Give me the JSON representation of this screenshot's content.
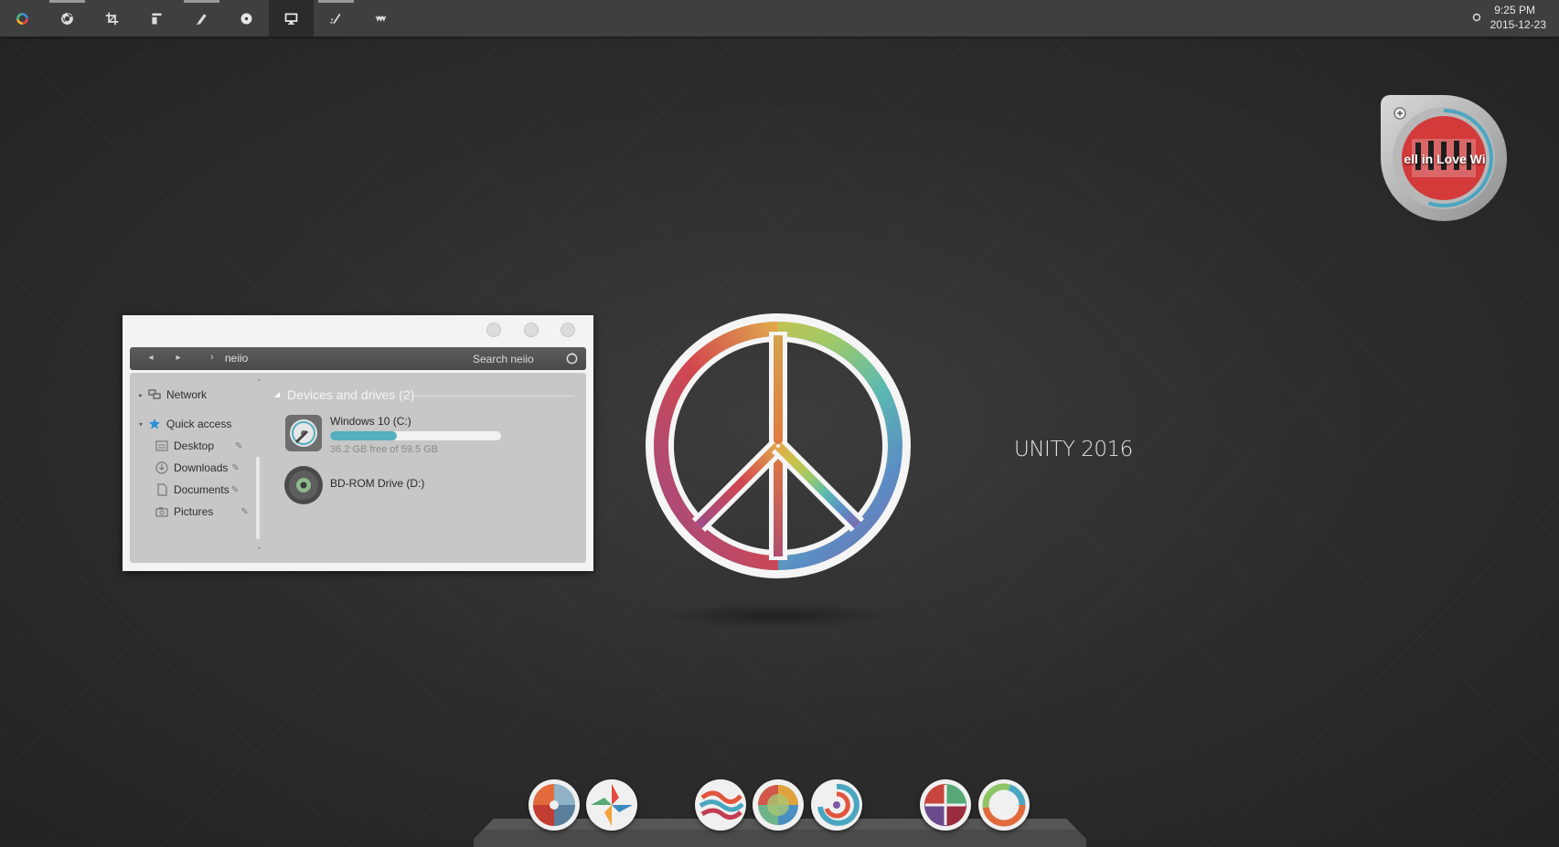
{
  "taskbar": {
    "buttons": [
      {
        "name": "color-ring-icon",
        "active": false,
        "open": false
      },
      {
        "name": "chrome-icon",
        "active": false,
        "open": true
      },
      {
        "name": "crop-tool-icon",
        "active": false,
        "open": false
      },
      {
        "name": "layout-icon",
        "active": false,
        "open": false
      },
      {
        "name": "brush-icon",
        "active": false,
        "open": true
      },
      {
        "name": "record-icon",
        "active": false,
        "open": false
      },
      {
        "name": "monitor-icon",
        "active": true,
        "open": false
      },
      {
        "name": "pen-icon",
        "active": false,
        "open": true
      },
      {
        "name": "bat-icon",
        "active": false,
        "open": false
      }
    ],
    "clock": {
      "time": "9:25 PM",
      "date": "2015-12-23"
    }
  },
  "explorer": {
    "path": "neiio",
    "search_placeholder": "Search neiio",
    "nav_items": [
      {
        "label": "Network",
        "icon": "network-icon",
        "pinned": false
      },
      {
        "label": "Quick access",
        "icon": "star-icon",
        "pinned": false
      },
      {
        "label": "Desktop",
        "icon": "desktop-icon",
        "pinned": true
      },
      {
        "label": "Downloads",
        "icon": "download-icon",
        "pinned": true
      },
      {
        "label": "Documents",
        "icon": "document-icon",
        "pinned": true
      },
      {
        "label": "Pictures",
        "icon": "camera-icon",
        "pinned": true
      }
    ],
    "section_title": "Devices and drives (2)",
    "drives": [
      {
        "name": "Windows 10 (C:)",
        "free_text": "36.2 GB free of 59.5 GB",
        "used_fraction": 0.39,
        "icon": "hard-drive-icon"
      },
      {
        "name": "BD-ROM Drive (D:)",
        "free_text": "",
        "icon": "disc-drive-icon"
      }
    ]
  },
  "desktop": {
    "caption": "UNITY 2016",
    "logo": "peace-sign-icon"
  },
  "music_widget": {
    "track_text": "ell in Love Wi",
    "album_title": "THE WHITE STRIPES",
    "icon": "album-art-icon"
  },
  "dock": {
    "icons": [
      "app-icon-1",
      "app-icon-2",
      "app-icon-3",
      "app-icon-4",
      "app-icon-5",
      "app-icon-6",
      "app-icon-7"
    ]
  },
  "colors": {
    "accent": "#53aebd",
    "taskbar": "#3f3f3f",
    "desktop": "#2c2c2c"
  }
}
